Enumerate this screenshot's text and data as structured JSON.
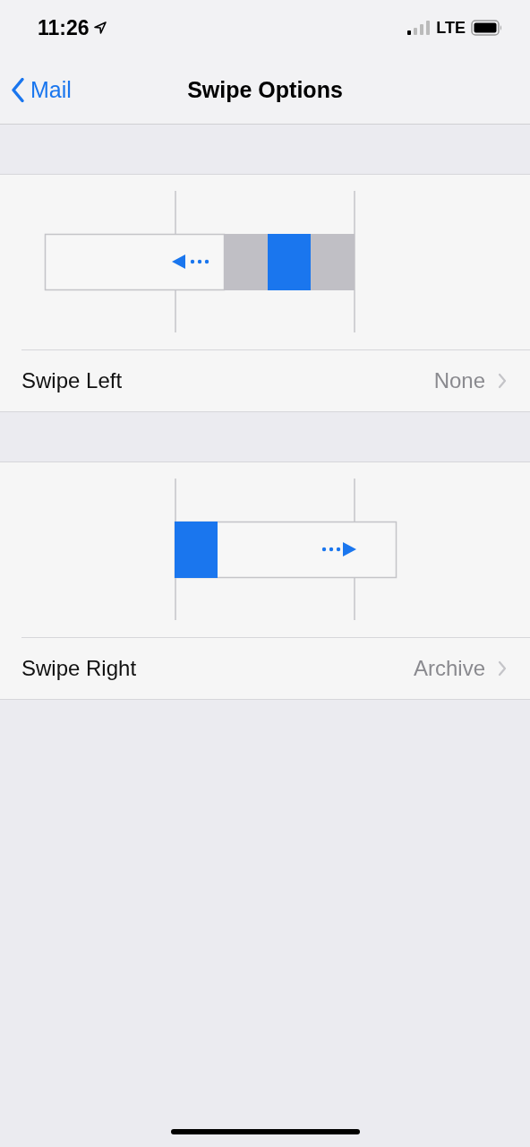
{
  "status_bar": {
    "time": "11:26",
    "network": "LTE"
  },
  "nav_bar": {
    "back": "Mail",
    "title": "Swipe Options"
  },
  "sections": [
    {
      "kind": "left",
      "label": "Swipe Left",
      "value": "None"
    },
    {
      "kind": "right",
      "label": "Swipe Right",
      "value": "Archive"
    }
  ]
}
